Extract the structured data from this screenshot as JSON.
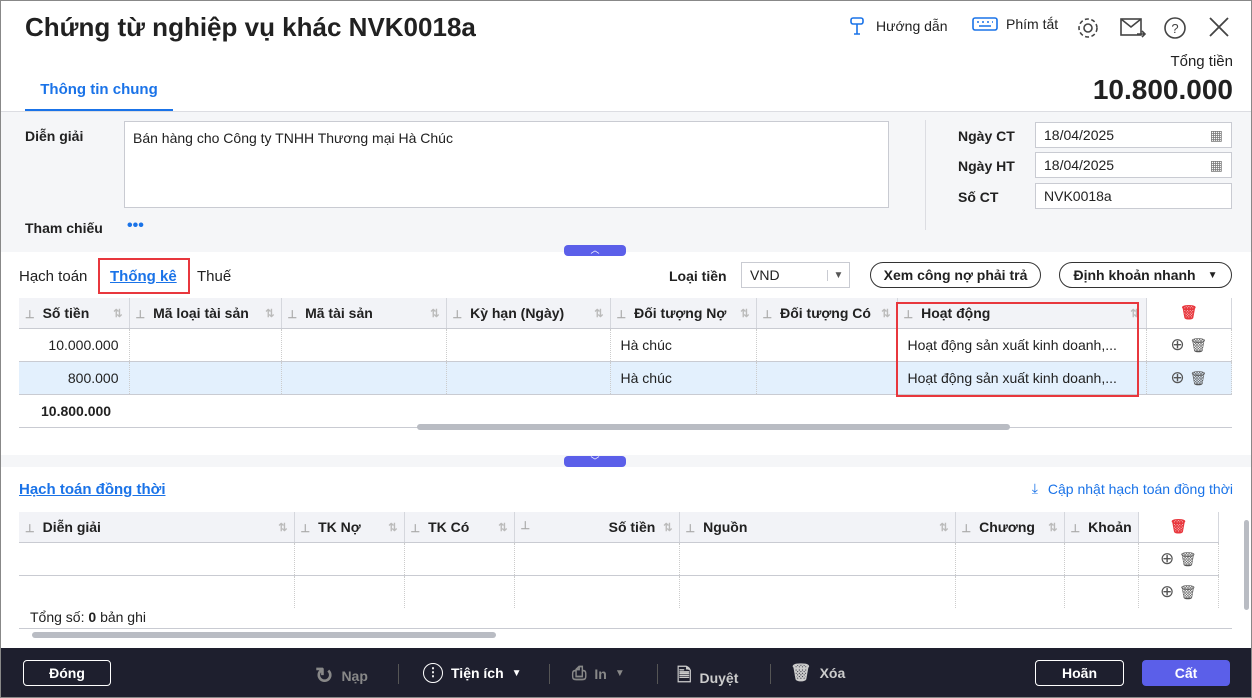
{
  "header": {
    "title": "Chứng từ nghiệp vụ khác NVK0018a",
    "guide": "Hướng dẫn",
    "shortcuts": "Phím tắt",
    "total_label": "Tổng tiền",
    "total_value": "10.800.000"
  },
  "tabs": [
    {
      "label": "Thông tin chung"
    }
  ],
  "form": {
    "dien_giai_label": "Diễn giải",
    "dien_giai_value": "Bán hàng cho Công ty TNHH Thương mại Hà Chúc",
    "tham_chieu_label": "Tham chiếu",
    "tham_chieu_more": "•••",
    "ngay_ct_label": "Ngày CT",
    "ngay_ct": "18/04/2025",
    "ngay_ht_label": "Ngày HT",
    "ngay_ht": "18/04/2025",
    "so_ct_label": "Số CT",
    "so_ct": "NVK0018a"
  },
  "subtabs": [
    "Hạch toán",
    "Thống kê",
    "Thuế"
  ],
  "currency": {
    "label": "Loại tiền",
    "value": "VND"
  },
  "buttons": {
    "xem_cong_no": "Xem công nợ phải trả",
    "dinh_khoan": "Định khoản nhanh"
  },
  "grid1": {
    "columns": [
      "Số tiền",
      "Mã loại tài sản",
      "Mã tài sản",
      "Kỳ hạn (Ngày)",
      "Đối tượng Nợ",
      "Đối tượng Có",
      "Hoạt động"
    ],
    "rows": [
      [
        "10.000.000",
        "",
        "",
        "",
        "Hà chúc",
        "",
        "Hoạt động sản xuất kinh doanh,..."
      ],
      [
        "800.000",
        "",
        "",
        "",
        "Hà chúc",
        "",
        "Hoạt động sản xuất kinh doanh,..."
      ]
    ],
    "total": "10.800.000"
  },
  "section2": {
    "title": "Hạch toán đồng thời",
    "update": "Cập nhật hạch toán đồng thời"
  },
  "grid2": {
    "columns": [
      "Diễn giải",
      "TK Nợ",
      "TK Có",
      "Số tiền",
      "Nguồn",
      "Chương",
      "Khoản"
    ],
    "count_prefix": "Tổng số:",
    "count": "0",
    "count_suffix": "bản ghi"
  },
  "footer": {
    "close": "Đóng",
    "reload": "Nạp",
    "utilities": "Tiện ích",
    "print": "In",
    "approve": "Duyệt",
    "delete": "Xóa",
    "cancel": "Hoãn",
    "save": "Cất"
  },
  "colors": {
    "accent": "#1a73e8",
    "primary": "#5b5fe9",
    "highlight": "#e8373d",
    "footer": "#1e1f2e"
  }
}
